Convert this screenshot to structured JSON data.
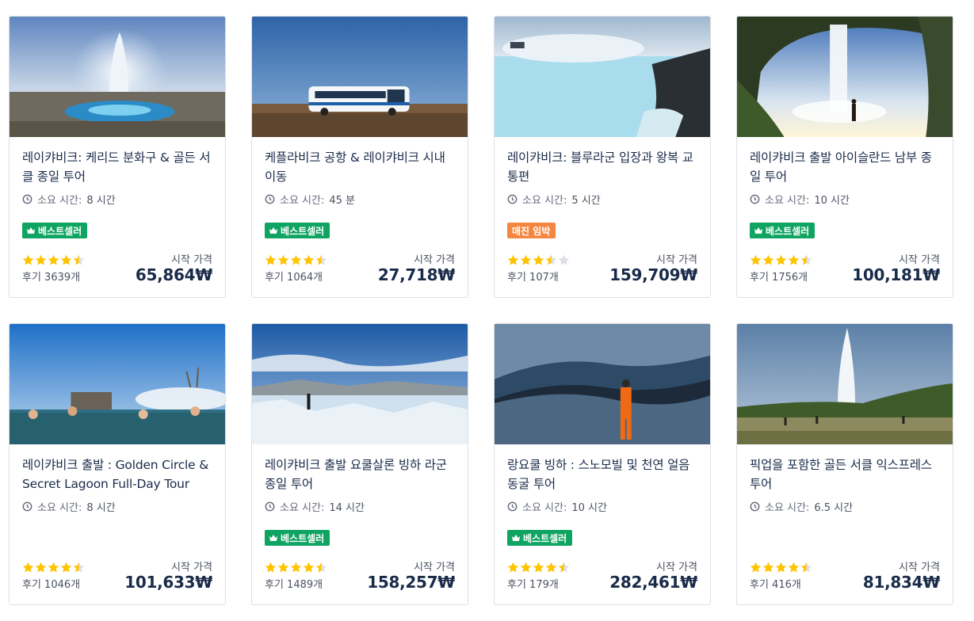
{
  "labels": {
    "from": "시작 가격",
    "best": "베스트셀러",
    "soon": "매진 임박"
  },
  "colors": {
    "bestseller": "#0fa461",
    "selling_out": "#f4863f",
    "star": "#ffc400",
    "star_empty": "#dcdfe4",
    "text": "#1a2b49"
  },
  "tours": [
    {
      "title": "레이캬비크: 케리드 분화구 & 골든 서클 종일 투어",
      "duration_label": "소요 시간:",
      "duration_value": "8 시간",
      "badge": "best",
      "badge_text": "베스트셀러",
      "rating": 4.5,
      "reviews": "후기 3639개",
      "price": "65,864₩",
      "image": "geyser-icon"
    },
    {
      "title": "케플라비크 공항 & 레이캬비크 시내 이동",
      "duration_label": "소요 시간:",
      "duration_value": "45 분",
      "badge": "best",
      "badge_text": "베스트셀러",
      "rating": 4.5,
      "reviews": "후기 1064개",
      "price": "27,718₩",
      "image": "bus-icon"
    },
    {
      "title": "레이캬비크: 블루라군 입장과 왕복 교통편",
      "duration_label": "소요 시간:",
      "duration_value": "5 시간",
      "badge": "soon",
      "badge_text": "매진 임박",
      "rating": 3.5,
      "reviews": "후기 107개",
      "price": "159,709₩",
      "image": "lagoon-icon"
    },
    {
      "title": "레이캬비크 출발 아이슬란드 남부 종일 투어",
      "duration_label": "소요 시간:",
      "duration_value": "10 시간",
      "badge": "best",
      "badge_text": "베스트셀러",
      "rating": 4.5,
      "reviews": "후기 1756개",
      "price": "100,181₩",
      "image": "waterfall-icon"
    },
    {
      "title": "레이캬비크 출발 : Golden Circle & Secret Lagoon Full-Day Tour",
      "duration_label": "소요 시간:",
      "duration_value": "8 시간",
      "badge": "",
      "badge_text": "",
      "rating": 4.5,
      "reviews": "후기 1046개",
      "price": "101,633₩",
      "image": "hotspring-icon"
    },
    {
      "title": "레이캬비크 출발 요쿨살론 빙하 라군 종일 투어",
      "duration_label": "소요 시간:",
      "duration_value": "14 시간",
      "badge": "best",
      "badge_text": "베스트셀러",
      "rating": 4.5,
      "reviews": "후기 1489개",
      "price": "158,257₩",
      "image": "glacier-icon"
    },
    {
      "title": "랑요쿨 빙하 : 스노모빌 및 천연 얼음 동굴 투어",
      "duration_label": "소요 시간:",
      "duration_value": "10 시간",
      "badge": "best",
      "badge_text": "베스트셀러",
      "rating": 4.5,
      "reviews": "후기 179개",
      "price": "282,461₩",
      "image": "icecave-icon"
    },
    {
      "title": "픽업을 포함한 골든 서클 익스프레스 투어",
      "duration_label": "소요 시간:",
      "duration_value": "6.5 시간",
      "badge": "",
      "badge_text": "",
      "rating": 4.5,
      "reviews": "후기 416개",
      "price": "81,834₩",
      "image": "geyser-field-icon"
    }
  ]
}
